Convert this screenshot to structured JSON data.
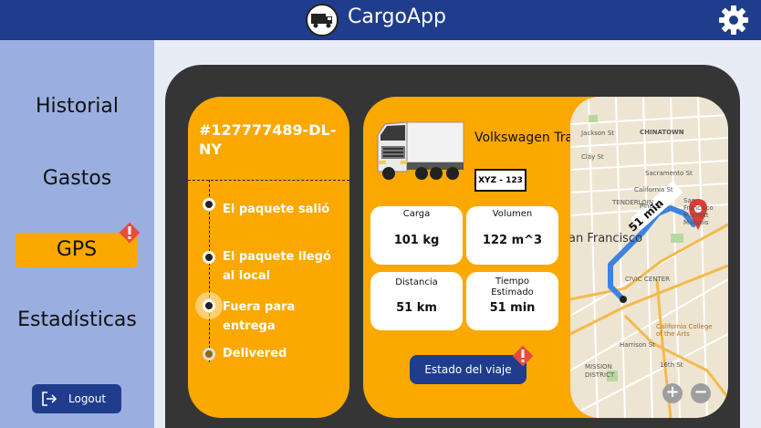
{
  "header": {
    "title": "CargoApp"
  },
  "sidebar": {
    "items": [
      {
        "label": "Historial"
      },
      {
        "label": "Gastos"
      },
      {
        "label": "GPS"
      },
      {
        "label": "Estadísticas"
      }
    ],
    "logout_label": "Logout"
  },
  "tracking": {
    "id": "#127777489-DL-NY",
    "steps": [
      {
        "label": "El paquete salió"
      },
      {
        "label": "El paquete llegó al local"
      },
      {
        "label": "Fuera para entrega"
      },
      {
        "label": "Delivered"
      }
    ]
  },
  "vehicle": {
    "name": "Volkswagen Transporter",
    "plate": "XYZ - 123",
    "stats": [
      {
        "label": "Carga",
        "value": "101 kg"
      },
      {
        "label": "Volumen",
        "value": "122 m^3"
      },
      {
        "label": "Distancia",
        "value": "51 km"
      },
      {
        "label": "Tiempo Estimado",
        "value": "51 min"
      }
    ],
    "trip_button": "Estado del viaje"
  },
  "map": {
    "route_label": "51 min",
    "labels": [
      "Jackson St",
      "CHINATOWN",
      "Clay St",
      "Sacramento St",
      "California St",
      "Pine St",
      "TENDERLOIN",
      "San Francisco Marriott Marquis",
      "an Francisco",
      "CIVIC CENTER",
      "California College of the Arts",
      "MISSION DISTRICT",
      "Harrison St",
      "16th St"
    ],
    "zoom_in": "+",
    "zoom_out": "−"
  },
  "colors": {
    "header": "#1f3d8c",
    "sidebar": "#9aafdf",
    "accent": "#fba800",
    "panel": "#353535",
    "alert": "#e74c3c"
  }
}
